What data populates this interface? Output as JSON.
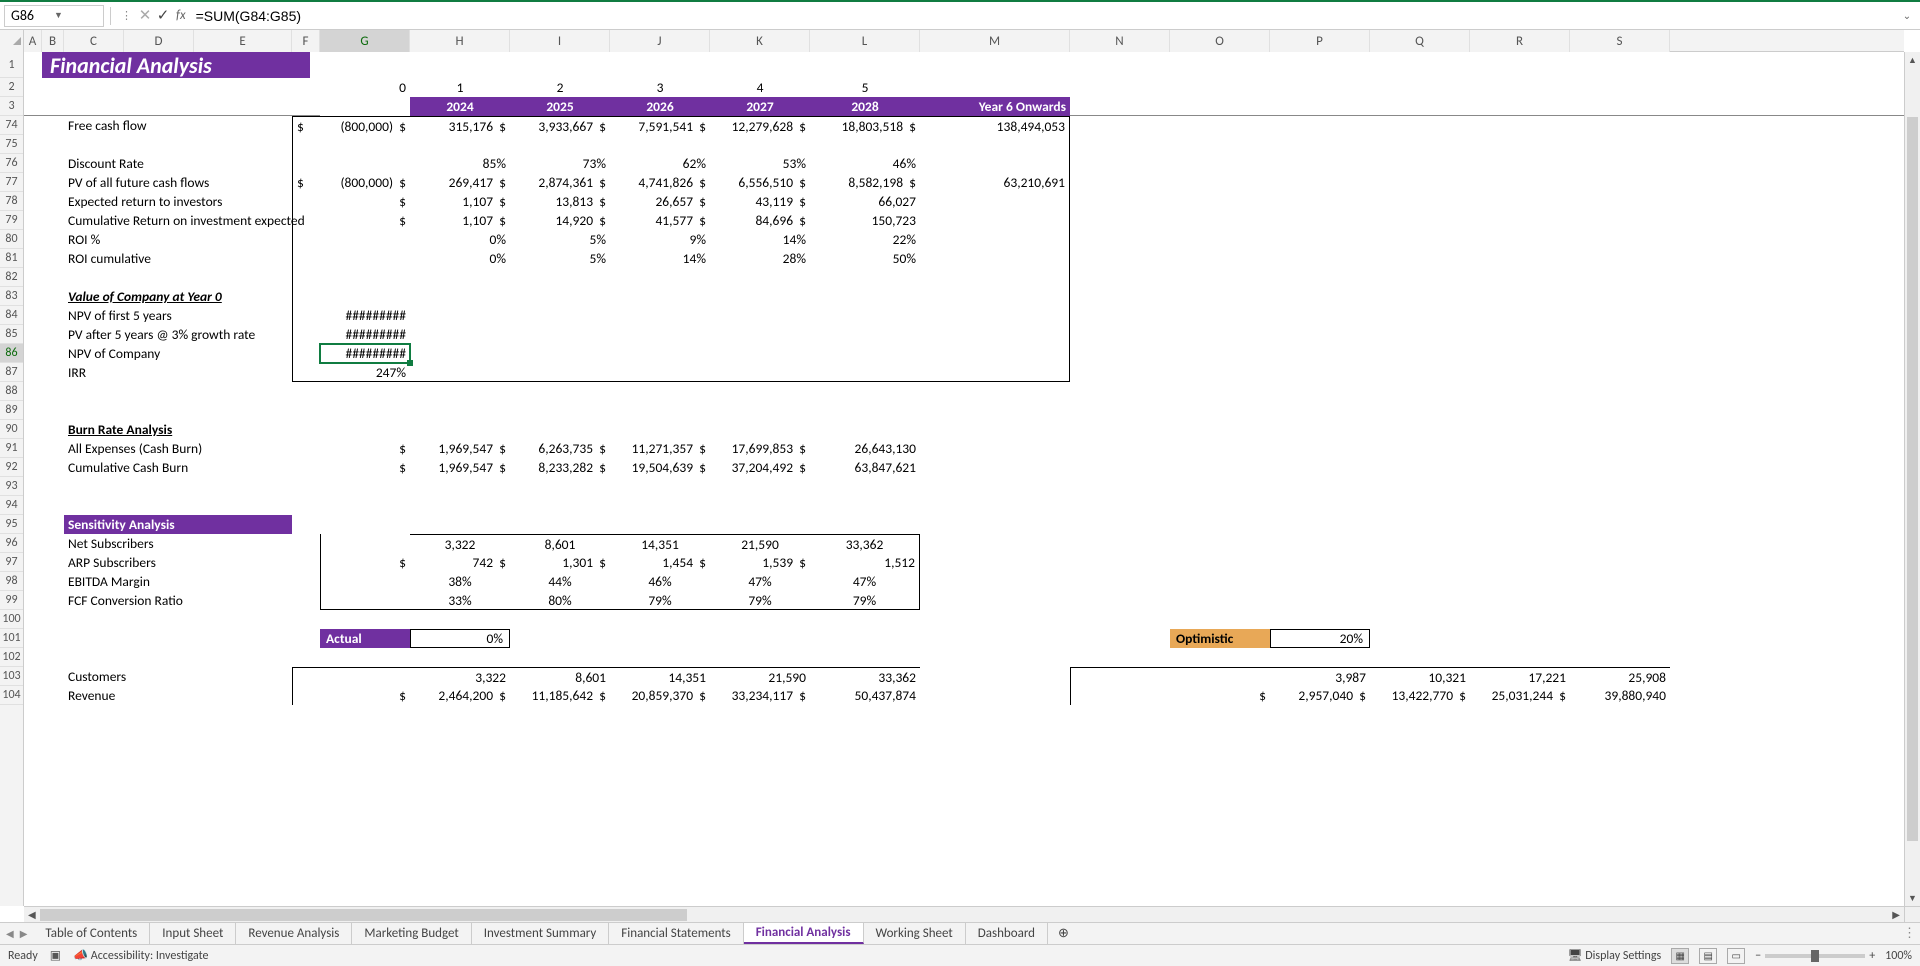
{
  "namebox": "G86",
  "formula": "=SUM(G84:G85)",
  "col_headers": [
    "A",
    "B",
    "C",
    "D",
    "E",
    "F",
    "G",
    "H",
    "I",
    "J",
    "K",
    "L",
    "M",
    "N",
    "O",
    "P",
    "Q",
    "R",
    "S"
  ],
  "row_nums": [
    "1",
    "2",
    "3",
    "74",
    "75",
    "76",
    "77",
    "78",
    "79",
    "80",
    "81",
    "82",
    "83",
    "84",
    "85",
    "86",
    "87",
    "88",
    "89",
    "90",
    "91",
    "92",
    "93",
    "94",
    "95",
    "96",
    "97",
    "98",
    "99",
    "100",
    "101",
    "102",
    "103",
    "104"
  ],
  "title": "Financial Analysis",
  "period_idx": [
    "0",
    "1",
    "2",
    "3",
    "4",
    "5"
  ],
  "years": [
    "2024",
    "2025",
    "2026",
    "2027",
    "2028",
    "Year 6 Onwards"
  ],
  "labels": {
    "fcf": "Free cash flow",
    "discount": "Discount Rate",
    "pv_flows": "PV of all future cash flows",
    "exp_return": "Expected return to investors",
    "cum_return": "Cumulative Return on investment expected",
    "roi_pct": "ROI %",
    "roi_cum": "ROI cumulative",
    "val_header": "Value of Company at Year 0",
    "npv5": "NPV of first 5 years",
    "pv_after5": "PV after 5 years @ 3% growth rate",
    "npv_company": "NPV of Company",
    "irr": "IRR",
    "burn_header": "Burn Rate Analysis",
    "all_exp": "All Expenses (Cash Burn)",
    "cum_burn": "Cumulative Cash Burn",
    "sens_header": "Sensitivity Analysis",
    "net_sub": "Net Subscribers",
    "arp_sub": "ARP Subscribers",
    "ebitda": "EBITDA Margin",
    "fcf_conv": "FCF Conversion Ratio",
    "actual": "Actual",
    "actual_pct": "0%",
    "optimistic": "Optimistic",
    "opt_pct": "20%",
    "customers": "Customers",
    "revenue": "Revenue"
  },
  "fcf": [
    "$",
    "(800,000)",
    "$",
    "315,176",
    "$",
    "3,933,667",
    "$",
    "7,591,541",
    "$",
    "12,279,628",
    "$",
    "18,803,518",
    "$",
    "138,494,053"
  ],
  "discount": [
    "85%",
    "73%",
    "62%",
    "53%",
    "46%"
  ],
  "pv_flows": [
    "$",
    "(800,000)",
    "$",
    "269,417",
    "$",
    "2,874,361",
    "$",
    "4,741,826",
    "$",
    "6,556,510",
    "$",
    "8,582,198",
    "$",
    "63,210,691"
  ],
  "exp_return": [
    "$",
    "1,107",
    "$",
    "13,813",
    "$",
    "26,657",
    "$",
    "43,119",
    "$",
    "66,027"
  ],
  "cum_return": [
    "$",
    "1,107",
    "$",
    "14,920",
    "$",
    "41,577",
    "$",
    "84,696",
    "$",
    "150,723"
  ],
  "roi_pct": [
    "0%",
    "5%",
    "9%",
    "14%",
    "22%"
  ],
  "roi_cum": [
    "0%",
    "5%",
    "14%",
    "28%",
    "50%"
  ],
  "hash": "#########",
  "irr": "247%",
  "all_exp": [
    "$",
    "1,969,547",
    "$",
    "6,263,735",
    "$",
    "11,271,357",
    "$",
    "17,699,853",
    "$",
    "26,643,130"
  ],
  "cum_burn_v": [
    "$",
    "1,969,547",
    "$",
    "8,233,282",
    "$",
    "19,504,639",
    "$",
    "37,204,492",
    "$",
    "63,847,621"
  ],
  "net_sub": [
    "3,322",
    "8,601",
    "14,351",
    "21,590",
    "33,362"
  ],
  "arp_sub": [
    "$",
    "742",
    "$",
    "1,301",
    "$",
    "1,454",
    "$",
    "1,539",
    "$",
    "1,512"
  ],
  "ebitda": [
    "38%",
    "44%",
    "46%",
    "47%",
    "47%"
  ],
  "fcf_conv": [
    "33%",
    "80%",
    "79%",
    "79%",
    "79%"
  ],
  "customers_a": [
    "3,322",
    "8,601",
    "14,351",
    "21,590",
    "33,362"
  ],
  "revenue_a": [
    "$",
    "2,464,200",
    "$",
    "11,185,642",
    "$",
    "20,859,370",
    "$",
    "33,234,117",
    "$",
    "50,437,874"
  ],
  "customers_o": [
    "3,987",
    "10,321",
    "17,221",
    "25,908"
  ],
  "revenue_o": [
    "$",
    "2,957,040",
    "$",
    "13,422,770",
    "$",
    "25,031,244",
    "$",
    "39,880,940"
  ],
  "tabs": [
    "Table of Contents",
    "Input Sheet",
    "Revenue Analysis",
    "Marketing Budget",
    "Investment Summary",
    "Financial Statements",
    "Financial Analysis",
    "Working Sheet",
    "Dashboard"
  ],
  "active_tab": "Financial Analysis",
  "status": {
    "ready": "Ready",
    "access": "Accessibility: Investigate",
    "display": "Display Settings",
    "zoom": "100%"
  }
}
